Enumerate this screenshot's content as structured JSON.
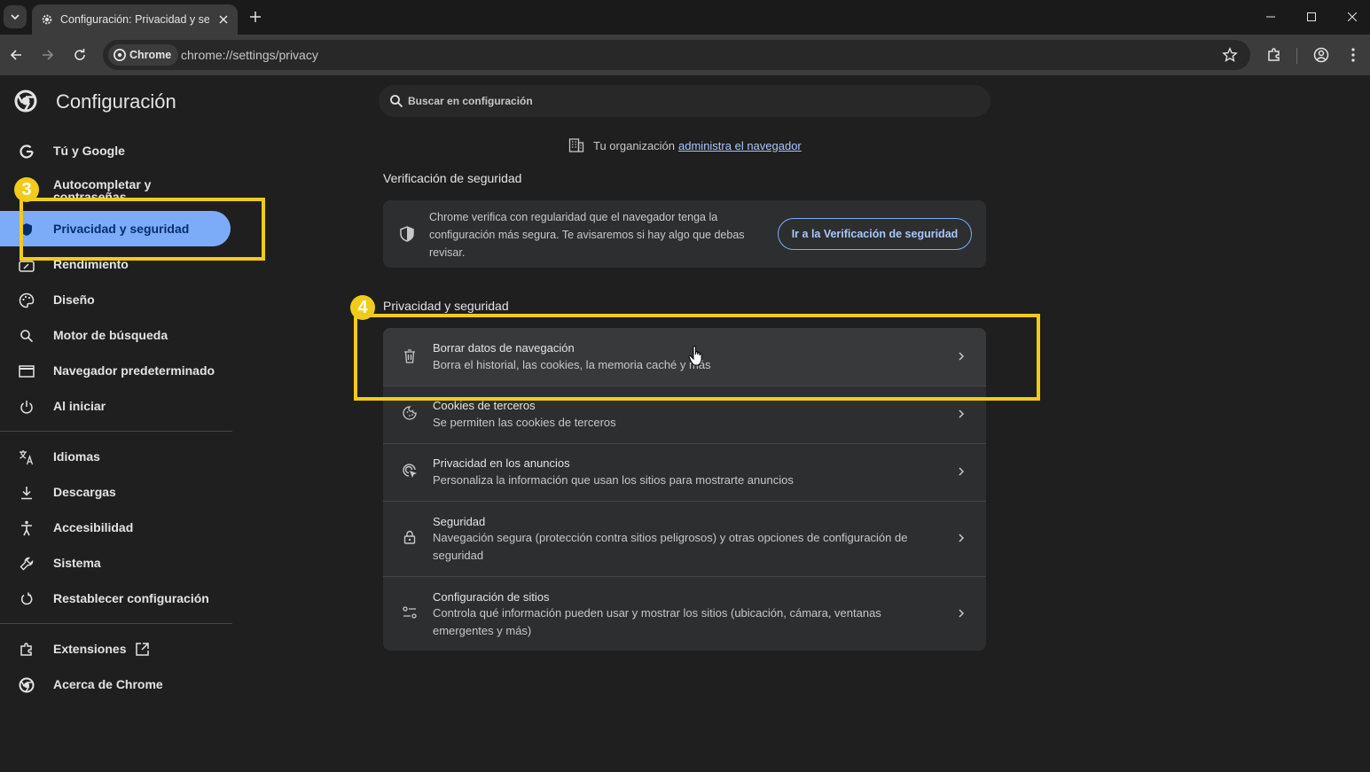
{
  "browser": {
    "tab_title": "Configuración: Privacidad y seg",
    "chip_label": "Chrome",
    "url": "chrome://settings/privacy"
  },
  "settings": {
    "title": "Configuración",
    "search_placeholder": "Buscar en configuración"
  },
  "sidebar": {
    "items": [
      {
        "label": "Tú y Google",
        "icon": "google-g-icon"
      },
      {
        "label": "Autocompletar y contraseñas",
        "icon": "clipboard-icon"
      },
      {
        "label": "Privacidad y seguridad",
        "icon": "shield-icon",
        "active": true
      },
      {
        "label": "Rendimiento",
        "icon": "speedometer-icon"
      },
      {
        "label": "Diseño",
        "icon": "palette-icon"
      },
      {
        "label": "Motor de búsqueda",
        "icon": "search-icon"
      },
      {
        "label": "Navegador predeterminado",
        "icon": "browser-window-icon"
      },
      {
        "label": "Al iniciar",
        "icon": "power-icon"
      },
      {
        "label": "Idiomas",
        "icon": "translate-icon"
      },
      {
        "label": "Descargas",
        "icon": "download-icon"
      },
      {
        "label": "Accesibilidad",
        "icon": "accessibility-icon"
      },
      {
        "label": "Sistema",
        "icon": "wrench-icon"
      },
      {
        "label": "Restablecer configuración",
        "icon": "reset-icon"
      },
      {
        "label": "Extensiones",
        "icon": "puzzle-icon"
      },
      {
        "label": "Acerca de Chrome",
        "icon": "chrome-logo-icon"
      }
    ]
  },
  "main": {
    "org_note_prefix": "Tu organización",
    "org_note_link": "administra el navegador",
    "safety_check": {
      "heading": "Verificación de seguridad",
      "text": "Chrome verifica con regularidad que el navegador tenga la configuración más segura. Te avisaremos si hay algo que debas revisar.",
      "button": "Ir a la Verificación de seguridad"
    },
    "privacy": {
      "heading": "Privacidad y seguridad",
      "rows": [
        {
          "title": "Borrar datos de navegación",
          "subtitle": "Borra el historial, las cookies, la memoria caché y más",
          "icon": "trash-icon"
        },
        {
          "title": "Cookies de terceros",
          "subtitle": "Se permiten las cookies de terceros",
          "icon": "cookie-icon"
        },
        {
          "title": "Privacidad en los anuncios",
          "subtitle": "Personaliza la información que usan los sitios para mostrarte anuncios",
          "icon": "ad-privacy-icon"
        },
        {
          "title": "Seguridad",
          "subtitle": "Navegación segura (protección contra sitios peligrosos) y otras opciones de configuración de seguridad",
          "icon": "lock-icon"
        },
        {
          "title": "Configuración de sitios",
          "subtitle": "Controla qué información pueden usar y mostrar los sitios (ubicación, cámara, ventanas emergentes y más)",
          "icon": "sliders-icon"
        }
      ]
    }
  },
  "annotations": {
    "step3": "3",
    "step4": "4",
    "highlight_color": "#f2cb1a"
  },
  "colors": {
    "accent": "#7cacf8",
    "link": "#a8c7fa",
    "background": "#1f1f1f"
  }
}
